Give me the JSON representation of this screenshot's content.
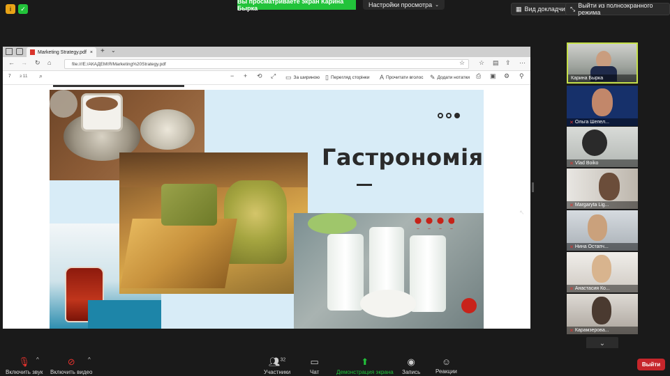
{
  "topbar": {
    "viewing_banner": "Вы просматриваете экран Карина Бырка",
    "view_settings": "Настройки просмотра",
    "speaker_view": "Вид докладчика",
    "exit_fullscreen": "Выйти из полноэкранного режима"
  },
  "browser": {
    "tab_title": "Marketing Strategy.pdf",
    "url": "file:///E:/АКАДЕМІЯ/Marketing%20Strategy.pdf"
  },
  "pdf_toolbar": {
    "page_current": "7",
    "page_total": "з 11",
    "fit_width": "За шириною",
    "page_view": "Перегляд сторінки",
    "read_aloud": "Прочитати вголос",
    "add_notes": "Додати нотатки"
  },
  "slide": {
    "title": "Гастрономія"
  },
  "participants": [
    {
      "name": "Карина Бырка",
      "muted": false,
      "active": true
    },
    {
      "name": "Ольга Шепел...",
      "muted": true,
      "active": false
    },
    {
      "name": "Vlad Boiko",
      "muted": true,
      "active": false
    },
    {
      "name": "Margaryta Lig...",
      "muted": true,
      "active": false
    },
    {
      "name": "Нина Остапч...",
      "muted": true,
      "active": false
    },
    {
      "name": "Анастасия Ко...",
      "muted": true,
      "active": false
    },
    {
      "name": "Карамзерова...",
      "muted": true,
      "active": false
    }
  ],
  "bottombar": {
    "mute": "Включить звук",
    "video": "Включить видео",
    "participants": "Участники",
    "participants_count": "32",
    "chat": "Чат",
    "share_screen": "Демонстрация экрана",
    "record": "Запись",
    "reactions": "Реакции",
    "leave": "Выйти"
  },
  "colors": {
    "banner_green": "#22c33a",
    "leave_red": "#c6262b",
    "active_speaker_border": "#c5e04a",
    "slide_bg": "#d8ecf7"
  }
}
